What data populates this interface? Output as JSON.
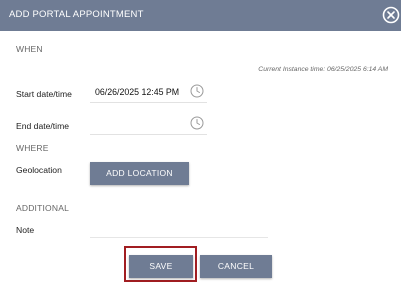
{
  "header": {
    "title": "ADD PORTAL APPOINTMENT",
    "close_icon": "close-circle-icon",
    "background_color": "#6f7c94"
  },
  "when": {
    "section_label": "WHEN",
    "instance_time": "Current Instance time: 06/25/2025 6:14 AM",
    "start": {
      "label": "Start date/time",
      "value": "06/26/2025 12:45 PM",
      "icon": "clock-icon"
    },
    "end": {
      "label": "End date/time",
      "value": "",
      "icon": "clock-icon"
    }
  },
  "where": {
    "section_label": "WHERE",
    "geolocation_label": "Geolocation",
    "add_location_label": "ADD LOCATION"
  },
  "additional": {
    "section_label": "ADDITIONAL",
    "note_label": "Note",
    "note_value": ""
  },
  "footer": {
    "save_label": "SAVE",
    "cancel_label": "CANCEL",
    "highlight_color": "#a11d21"
  }
}
